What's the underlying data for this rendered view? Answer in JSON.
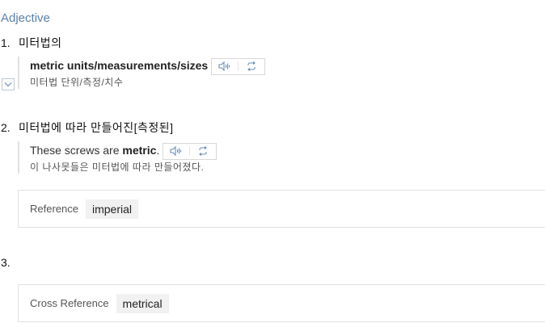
{
  "part_of_speech": "Adjective",
  "definitions": [
    {
      "number": "1.",
      "korean": "미터법의",
      "example": {
        "text_bold": "metric units/measurements/sizes",
        "translation": "미터법 단위/측정/치수"
      }
    },
    {
      "number": "2.",
      "korean": "미터법에 따라 만들어진[측정된]",
      "example": {
        "text_before": "These screws are ",
        "text_bold": "metric",
        "text_after": ".",
        "translation": "이 나사못들은 미터법에 따라 만들어졌다."
      },
      "reference": {
        "label": "Reference",
        "word": "imperial"
      }
    },
    {
      "number": "3.",
      "korean": "",
      "cross_reference": {
        "label": "Cross Reference",
        "word": "metrical"
      }
    }
  ],
  "icons": {
    "listen": "speaker-waves-icon",
    "repeat": "repeat-loop-icon",
    "expand": "chevron-down-icon"
  },
  "colors": {
    "pos_title": "#5b82a8",
    "icon": "#6a8fb5"
  }
}
